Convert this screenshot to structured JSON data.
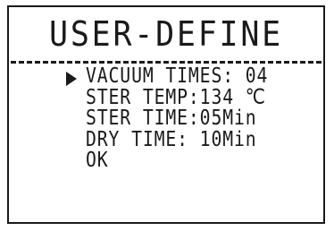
{
  "screen": {
    "title": "USER-DEFINE"
  },
  "menu": {
    "cursor_icon": "right-triangle-cursor",
    "items": [
      {
        "label": "VACUUM TIMES: 04"
      },
      {
        "label": "STER TEMP:134 ℃"
      },
      {
        "label": "STER TIME:05Min"
      },
      {
        "label": "DRY TIME: 10Min"
      },
      {
        "label": "OK"
      }
    ],
    "selected_index": 0
  }
}
